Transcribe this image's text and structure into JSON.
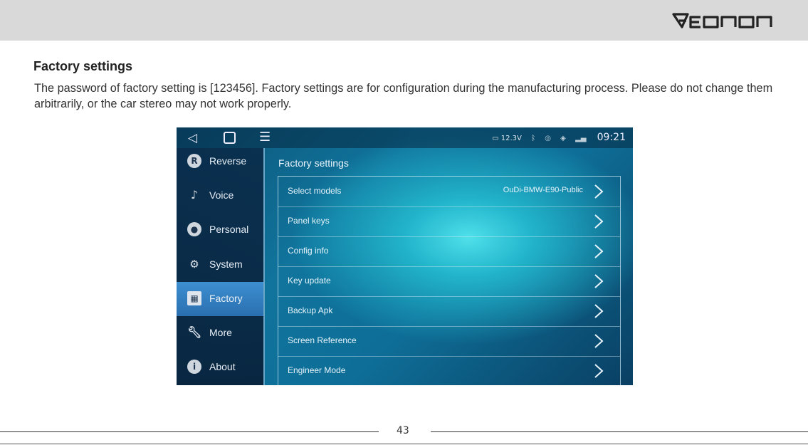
{
  "brand": {
    "logo_text": "Eonon",
    "header_color": "#d9d9d9"
  },
  "document": {
    "title": "Factory settings",
    "body": "The password of factory setting is [123456]. Factory settings are for configuration during the manufacturing process. Please do not change them arbitrarily, or the car stereo may not work properly."
  },
  "screen": {
    "status_bar": {
      "voltage": "12.3V",
      "time": "09:21"
    },
    "nav": {
      "back": "◁",
      "menu": "☰"
    },
    "sidebar": [
      {
        "label": "Reverse",
        "icon": "reverse-icon"
      },
      {
        "label": "Voice",
        "icon": "microphone-icon"
      },
      {
        "label": "Personal",
        "icon": "personal-icon"
      },
      {
        "label": "System",
        "icon": "system-icon"
      },
      {
        "label": "Factory",
        "icon": "factory-icon",
        "active": true
      },
      {
        "label": "More",
        "icon": "wrench-icon"
      },
      {
        "label": "About",
        "icon": "info-icon"
      }
    ],
    "panel_title": "Factory settings",
    "rows": [
      {
        "label": "Select models",
        "value": "OuDi-BMW-E90-Public"
      },
      {
        "label": "Panel keys"
      },
      {
        "label": "Config info"
      },
      {
        "label": "Key update"
      },
      {
        "label": "Backup Apk"
      },
      {
        "label": "Screen Reference"
      },
      {
        "label": "Engineer Mode"
      }
    ]
  },
  "footer": {
    "page_number": "43"
  }
}
